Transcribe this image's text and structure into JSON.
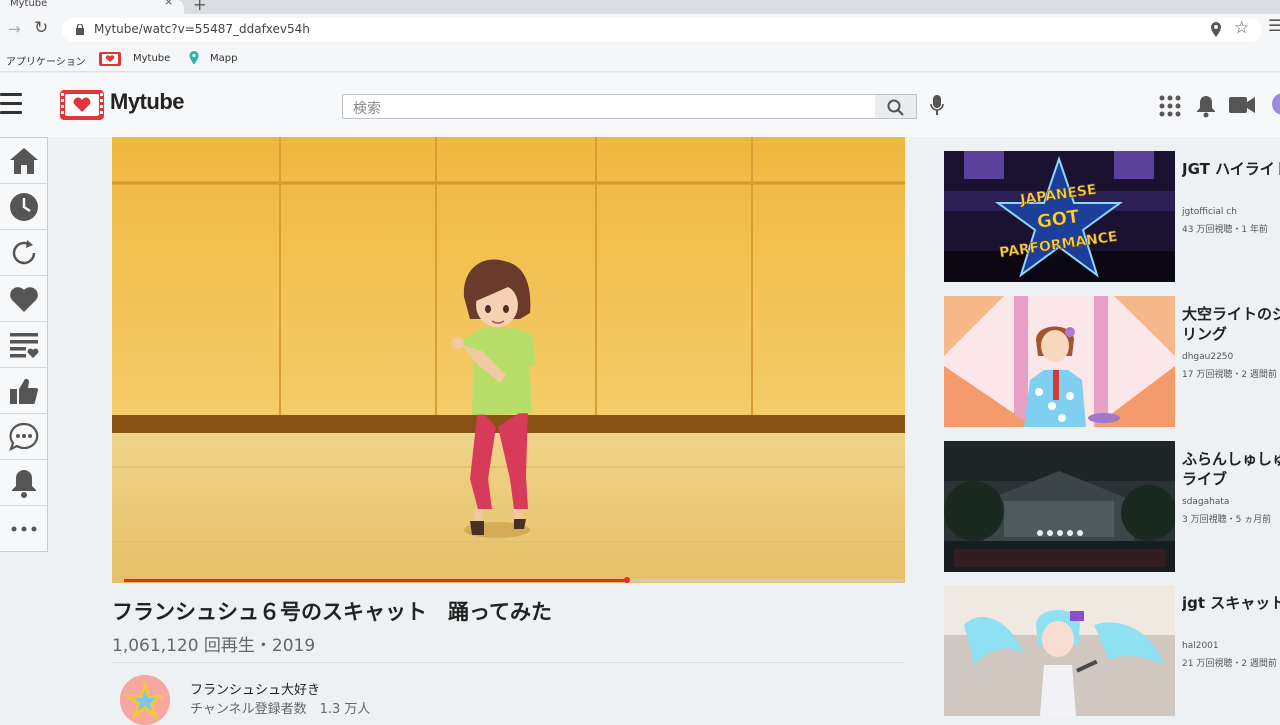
{
  "browser": {
    "tab_title": "Mytube",
    "url": "Mytube/watc?v=55487_ddafxev54h",
    "bookmarks": [
      "アプリケーション",
      "Mytube",
      "Mapp"
    ]
  },
  "header": {
    "brand": "Mytube",
    "search_placeholder": "検索"
  },
  "video": {
    "title": "フランシュシュ６号のスキャット　踊ってみた",
    "meta": "1,061,120 回再生・2019",
    "progress": 0.645,
    "channel_name": "フランシュシュ大好き",
    "channel_subs": "チャンネル登録者数　1.3 万人"
  },
  "sidebar": {
    "items": [
      "home-icon",
      "history-icon",
      "refresh-icon",
      "heart-icon",
      "playlist-icon",
      "thumbs-up-icon",
      "chat-icon",
      "bell-icon",
      "more-icon"
    ]
  },
  "recommendations": [
    {
      "title": "JGT ハイライト",
      "channel": "jgtofficial ch",
      "stats": "43 万回視聴・1 年前"
    },
    {
      "title": "大空ライトのジ リング",
      "channel": "dhgau2250",
      "stats": "17 万回視聴・2 週間前"
    },
    {
      "title": "ふらんしゅしゅ ライブ",
      "channel": "sdagahata",
      "stats": "3 万回視聴・5 ヵ月前"
    },
    {
      "title": "jgt スキャット",
      "channel": "hal2001",
      "stats": "21 万回視聴・2 週間前"
    }
  ],
  "thumb_text": {
    "line1": "JAPANESE",
    "line2": "GOT",
    "line3": "PARFORMANCE"
  },
  "colors": {
    "accent": "#e52d27",
    "brand_red": "#e0353b"
  }
}
